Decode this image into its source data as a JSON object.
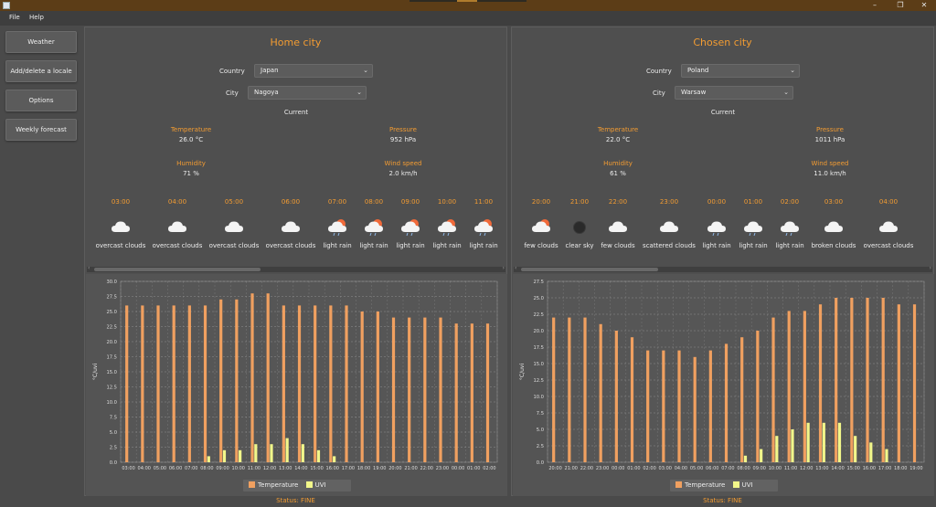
{
  "menu": {
    "file": "File",
    "help": "Help"
  },
  "window_controls": {
    "minimize": "–",
    "maximize": "❐",
    "close": "✕"
  },
  "sidebar": {
    "items": [
      {
        "label": "Weather"
      },
      {
        "label": "Add/delete a locale"
      },
      {
        "label": "Options"
      },
      {
        "label": "Weekly forecast"
      }
    ]
  },
  "home": {
    "title": "Home city",
    "country_label": "Country",
    "country": "Japan",
    "city_label": "City",
    "city": "Nagoya",
    "current_label": "Current",
    "temperature_label": "Temperature",
    "temperature": "26.0 °C",
    "pressure_label": "Pressure",
    "pressure": "952 hPa",
    "humidity_label": "Humidity",
    "humidity": "71 %",
    "wind_label": "Wind speed",
    "wind": "2.0 km/h",
    "hourly": [
      {
        "time": "03:00",
        "icon": "cloud-icon",
        "desc": "overcast clouds"
      },
      {
        "time": "04:00",
        "icon": "cloud-icon",
        "desc": "overcast clouds"
      },
      {
        "time": "05:00",
        "icon": "cloud-icon",
        "desc": "overcast clouds"
      },
      {
        "time": "06:00",
        "icon": "cloud-icon",
        "desc": "overcast clouds"
      },
      {
        "time": "07:00",
        "icon": "sun-cloud-rain-icon",
        "desc": "light rain"
      },
      {
        "time": "08:00",
        "icon": "sun-cloud-rain-icon",
        "desc": "light rain"
      },
      {
        "time": "09:00",
        "icon": "sun-cloud-rain-icon",
        "desc": "light rain"
      },
      {
        "time": "10:00",
        "icon": "sun-cloud-rain-icon",
        "desc": "light rain"
      },
      {
        "time": "11:00",
        "icon": "sun-cloud-rain-icon",
        "desc": "light rain"
      }
    ],
    "status": "Status: FINE"
  },
  "chosen": {
    "title": "Chosen city",
    "country_label": "Country",
    "country": "Poland",
    "city_label": "City",
    "city": "Warsaw",
    "current_label": "Current",
    "temperature_label": "Temperature",
    "temperature": "22.0 °C",
    "pressure_label": "Pressure",
    "pressure": "1011 hPa",
    "humidity_label": "Humidity",
    "humidity": "61 %",
    "wind_label": "Wind speed",
    "wind": "11.0 km/h",
    "hourly": [
      {
        "time": "20:00",
        "icon": "sun-cloud-icon",
        "desc": "few clouds"
      },
      {
        "time": "21:00",
        "icon": "moon-icon",
        "desc": "clear sky"
      },
      {
        "time": "22:00",
        "icon": "cloud-icon",
        "desc": "few clouds"
      },
      {
        "time": "23:00",
        "icon": "cloud-icon",
        "desc": "scattered clouds"
      },
      {
        "time": "00:00",
        "icon": "cloud-rain-icon",
        "desc": "light rain"
      },
      {
        "time": "01:00",
        "icon": "cloud-rain-icon",
        "desc": "light rain"
      },
      {
        "time": "02:00",
        "icon": "cloud-rain-icon",
        "desc": "light rain"
      },
      {
        "time": "03:00",
        "icon": "cloud-icon",
        "desc": "broken clouds"
      },
      {
        "time": "04:00",
        "icon": "cloud-icon",
        "desc": "overcast clouds"
      },
      {
        "time": "",
        "icon": "",
        "desc": "over"
      }
    ],
    "status": "Status: FINE"
  },
  "colors": {
    "accent": "#f39c32",
    "temperature": "#f0a060",
    "uvi": "#f2f78a"
  },
  "chart_data": [
    {
      "type": "bar",
      "panel": "home",
      "ylabel": "°C/uvi",
      "ylim": [
        0,
        30
      ],
      "yticks": [
        0.0,
        2.5,
        5.0,
        7.5,
        10.0,
        12.5,
        15.0,
        17.5,
        20.0,
        22.5,
        25.0,
        27.5,
        30.0
      ],
      "categories": [
        "03:00",
        "04:00",
        "05:00",
        "06:00",
        "07:00",
        "08:00",
        "09:00",
        "10:00",
        "11:00",
        "12:00",
        "13:00",
        "14:00",
        "15:00",
        "16:00",
        "17:00",
        "18:00",
        "19:00",
        "20:00",
        "21:00",
        "22:00",
        "23:00",
        "00:00",
        "01:00",
        "02:00"
      ],
      "series": [
        {
          "name": "Temperature",
          "values": [
            26,
            26,
            26,
            26,
            26,
            26,
            27,
            27,
            28,
            28,
            26,
            26,
            26,
            26,
            26,
            25,
            25,
            24,
            24,
            24,
            24,
            23,
            23,
            23
          ]
        },
        {
          "name": "UVI",
          "values": [
            0,
            0,
            0,
            0,
            0,
            1,
            2,
            2,
            3,
            3,
            4,
            3,
            2,
            1,
            0,
            0,
            0,
            0,
            0,
            0,
            0,
            0,
            0,
            0
          ]
        }
      ],
      "grid": true,
      "legend": "bottom-center"
    },
    {
      "type": "bar",
      "panel": "chosen",
      "ylabel": "°C/uvi",
      "ylim": [
        0,
        27.5
      ],
      "yticks": [
        0.0,
        2.5,
        5.0,
        7.5,
        10.0,
        12.5,
        15.0,
        17.5,
        20.0,
        22.5,
        25.0,
        27.5
      ],
      "categories": [
        "20:00",
        "21:00",
        "22:00",
        "23:00",
        "00:00",
        "01:00",
        "02:00",
        "03:00",
        "04:00",
        "05:00",
        "06:00",
        "07:00",
        "08:00",
        "09:00",
        "10:00",
        "11:00",
        "12:00",
        "13:00",
        "14:00",
        "15:00",
        "16:00",
        "17:00",
        "18:00",
        "19:00"
      ],
      "series": [
        {
          "name": "Temperature",
          "values": [
            22,
            22,
            22,
            21,
            20,
            19,
            17,
            17,
            17,
            16,
            17,
            18,
            19,
            20,
            22,
            23,
            23,
            24,
            25,
            25,
            25,
            25,
            24,
            24
          ]
        },
        {
          "name": "UVI",
          "values": [
            0,
            0,
            0,
            0,
            0,
            0,
            0,
            0,
            0,
            0,
            0,
            0,
            1,
            2,
            4,
            5,
            6,
            6,
            6,
            4,
            3,
            2,
            0,
            0
          ]
        }
      ],
      "grid": true,
      "legend": "bottom-center"
    }
  ]
}
